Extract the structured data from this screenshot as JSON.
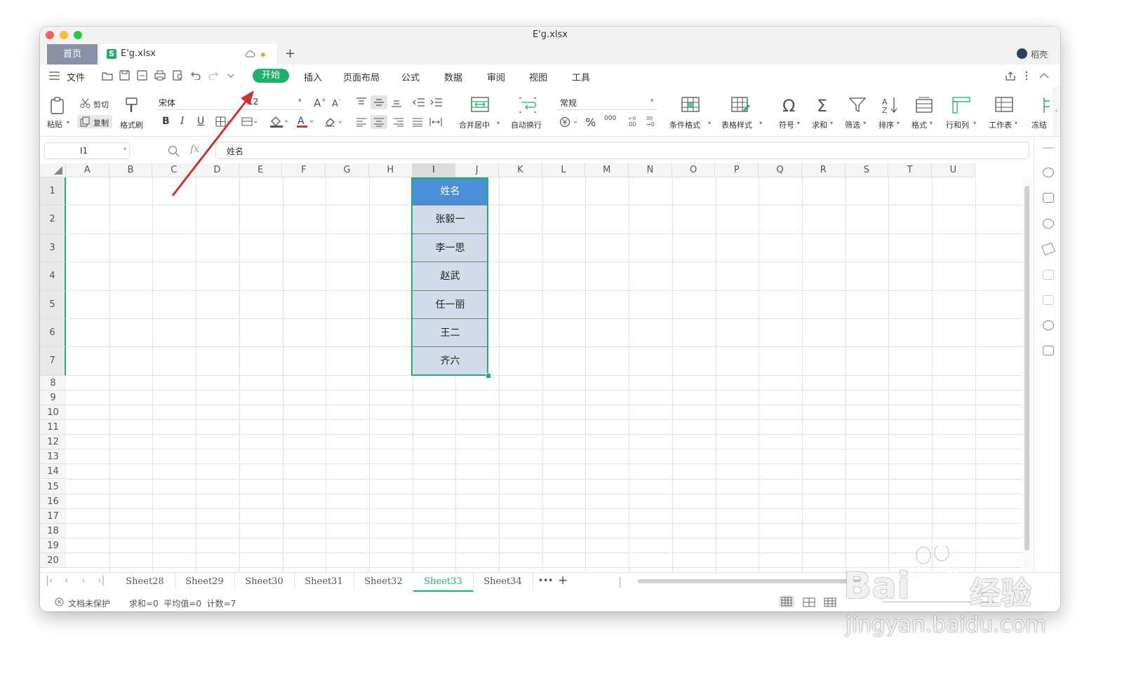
{
  "window": {
    "title": "E'g.xlsx"
  },
  "tabs": {
    "home": "首页",
    "doc": "E'g.xlsx",
    "new": "+",
    "user": "稻壳"
  },
  "menu": {
    "file": "文件",
    "items": [
      "开始",
      "插入",
      "页面布局",
      "公式",
      "数据",
      "审阅",
      "视图",
      "工具"
    ]
  },
  "ribbon": {
    "paste": "粘贴",
    "cut": "剪切",
    "copy": "复制",
    "format_painter": "格式刷",
    "font_name": "宋体",
    "font_size": "12",
    "bold": "B",
    "italic": "I",
    "underline": "U",
    "merge": "合并居中",
    "wrap": "自动换行",
    "number_format": "常规",
    "percent": "%",
    "thousands": "000",
    "cond_format": "条件格式",
    "table_style": "表格样式",
    "symbol": "符号",
    "sum": "求和",
    "filter": "筛选",
    "sort": "排序",
    "format": "格式",
    "rowcol": "行和列",
    "worksheet": "工作表",
    "freeze": "冻结"
  },
  "formula_bar": {
    "cell_ref": "I1",
    "fx": "fx",
    "content": "姓名"
  },
  "columns": [
    "A",
    "B",
    "C",
    "D",
    "E",
    "F",
    "G",
    "H",
    "I",
    "J",
    "K",
    "L",
    "M",
    "N",
    "O",
    "P",
    "Q",
    "R",
    "S",
    "T",
    "U"
  ],
  "rows": [
    "1",
    "2",
    "3",
    "4",
    "5",
    "6",
    "7",
    "8",
    "9",
    "10",
    "11",
    "12",
    "13",
    "14",
    "15",
    "16",
    "17",
    "18",
    "19",
    "20"
  ],
  "cells": [
    "姓名",
    "张毅一",
    "李一思",
    "赵武",
    "任一丽",
    "王二",
    "齐六"
  ],
  "sheets": [
    "Sheet28",
    "Sheet29",
    "Sheet30",
    "Sheet31",
    "Sheet32",
    "Sheet33",
    "Sheet34"
  ],
  "sheet_more": "•••",
  "sheet_add": "+",
  "status": {
    "protect": "文档未保护",
    "stats": "求和=0  平均值=0  计数=7"
  },
  "watermark": {
    "brand": "Bai",
    "brand2": "经验",
    "url": "jingyan.baidu.com"
  },
  "colors": {
    "accent": "#1fb069",
    "header_cell": "#4a90d9",
    "data_cell": "#d0dde8",
    "arrow": "#d32f2f"
  }
}
